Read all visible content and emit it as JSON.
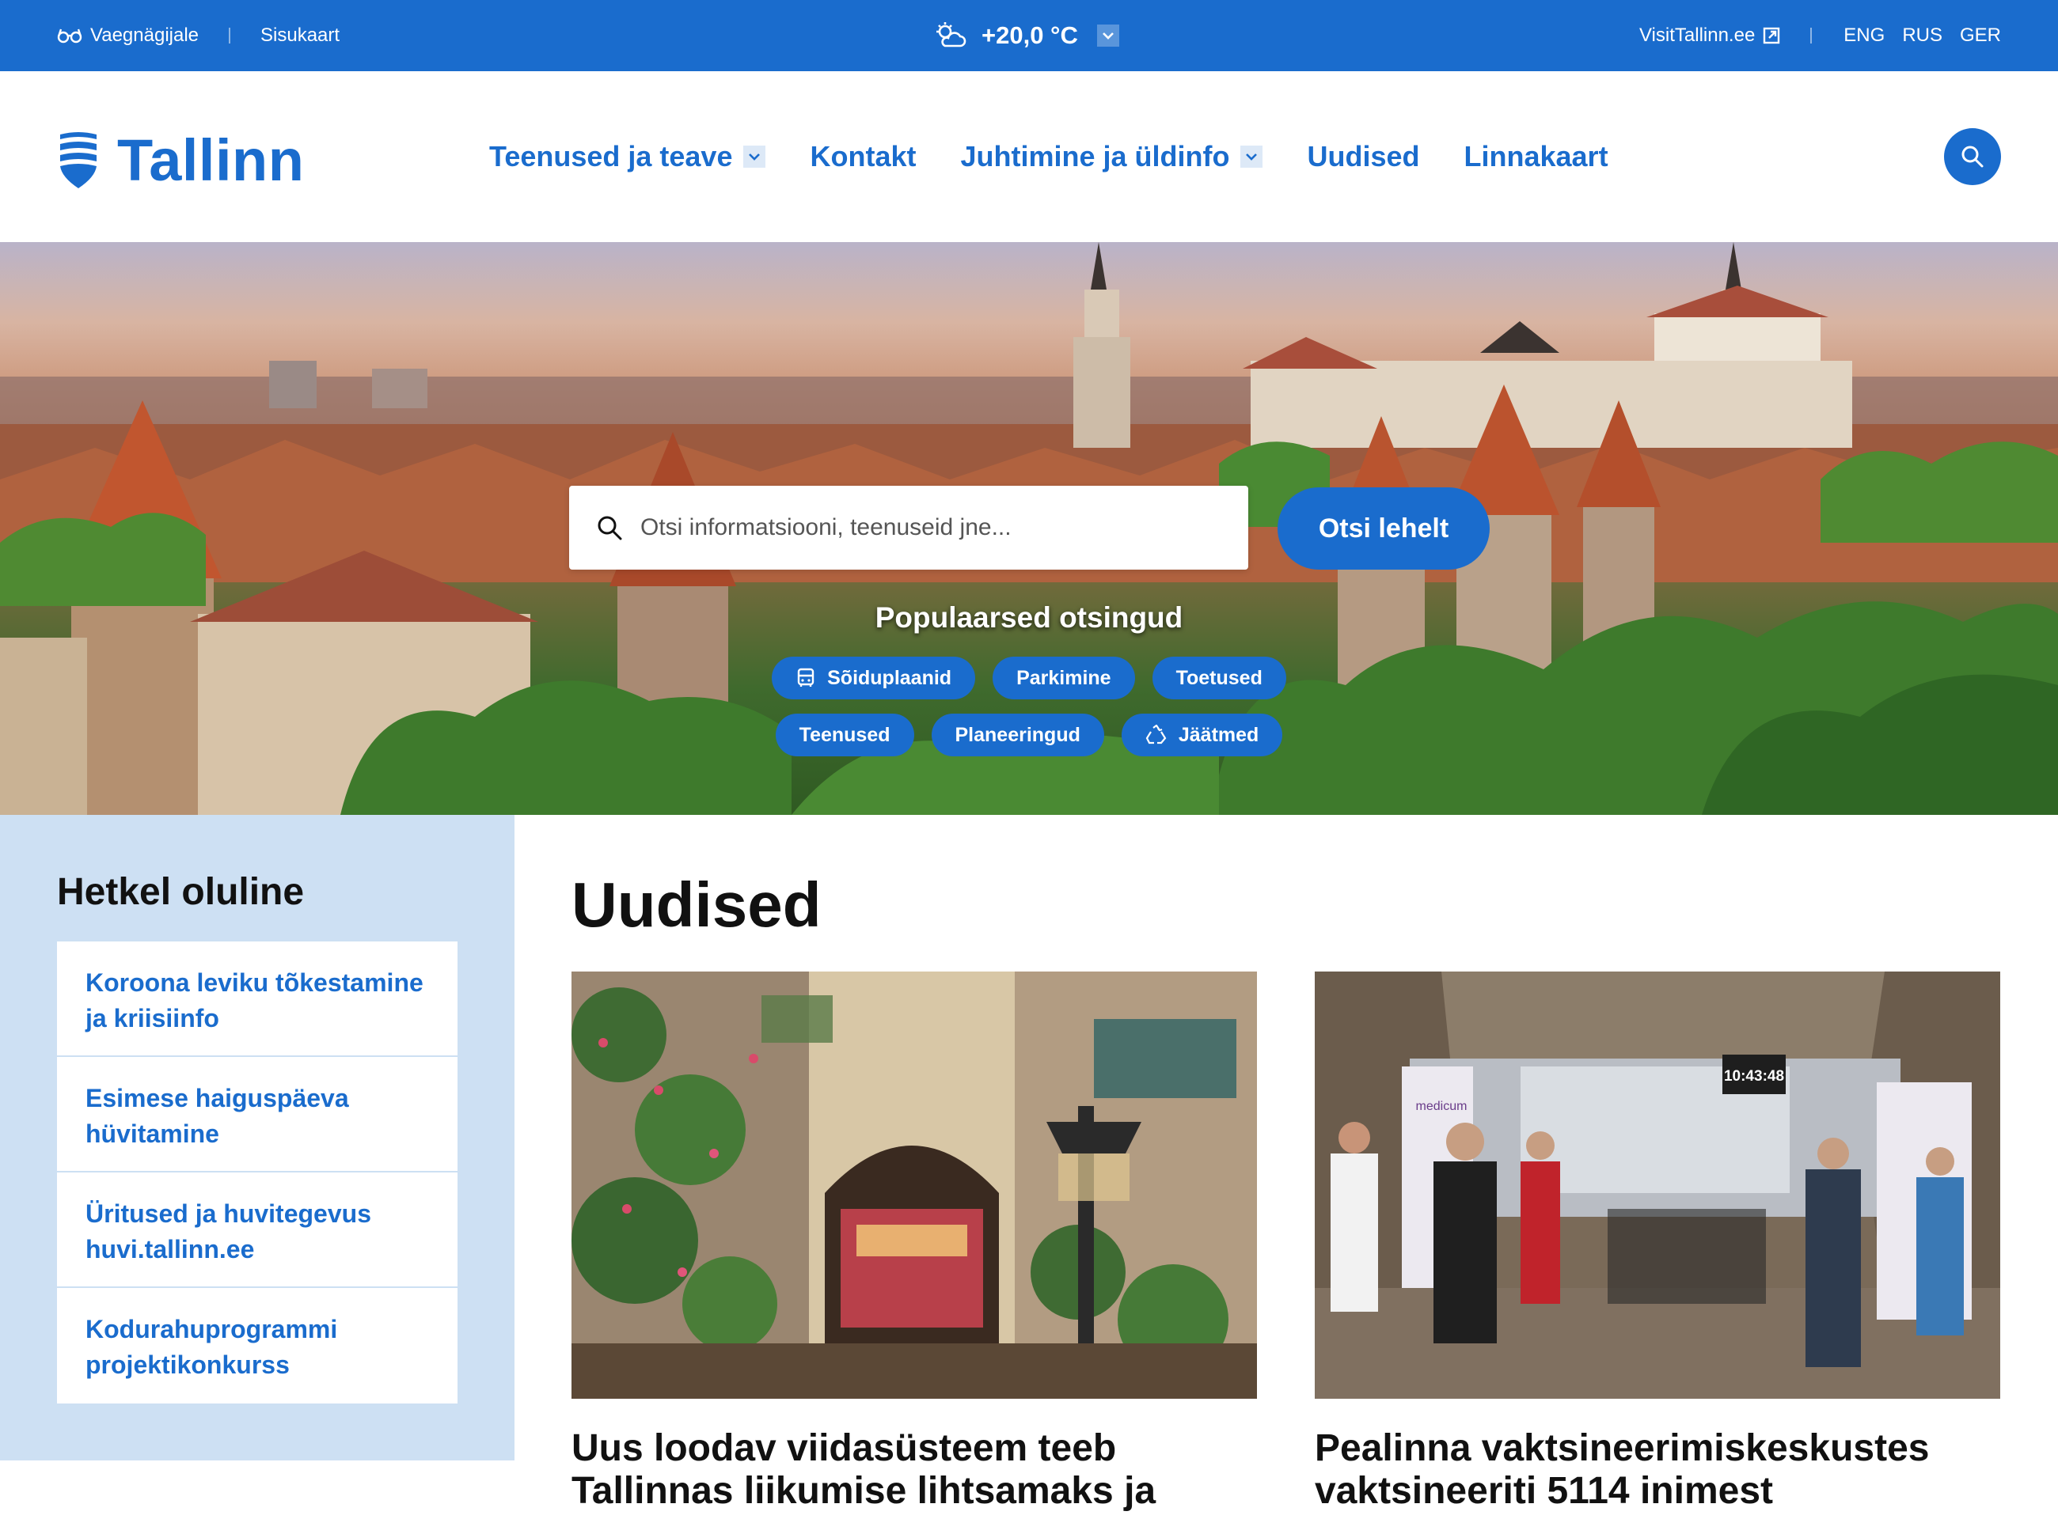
{
  "topbar": {
    "accessibility_label": "Vaegnägijale",
    "sitemap_label": "Sisukaart",
    "weather_temp": "+20,0 °C",
    "visit_label": "VisitTallinn.ee",
    "languages": [
      "ENG",
      "RUS",
      "GER"
    ]
  },
  "header": {
    "logo_text": "Tallinn",
    "nav": [
      {
        "label": "Teenused ja teave",
        "dropdown": true
      },
      {
        "label": "Kontakt",
        "dropdown": false
      },
      {
        "label": "Juhtimine ja üldinfo",
        "dropdown": true
      },
      {
        "label": "Uudised",
        "dropdown": false
      },
      {
        "label": "Linnakaart",
        "dropdown": false
      }
    ]
  },
  "hero": {
    "search_placeholder": "Otsi informatsiooni, teenuseid jne...",
    "search_button": "Otsi lehelt",
    "popular_title": "Populaarsed otsingud",
    "chips_row1": [
      "Sõiduplaanid",
      "Parkimine",
      "Toetused"
    ],
    "chips_row2": [
      "Teenused",
      "Planeeringud",
      "Jäätmed"
    ]
  },
  "important": {
    "title": "Hetkel oluline",
    "items": [
      "Koroona leviku tõkestamine ja kriisiinfo",
      "Esimese haiguspäeva hüvitamine",
      "Üritused ja huvitegevus huvi.tallinn.ee",
      "Kodurahuprogrammi projektikonkurss"
    ]
  },
  "news": {
    "title": "Uudised",
    "cards": [
      {
        "headline": "Uus loodav viidasüsteem teeb Tallinnas liikumise lihtsamaks ja"
      },
      {
        "headline": "Pealinna vaktsineerimiskeskustes vaktsineeriti 5114 inimest",
        "clock_text": "10:43:48",
        "banner_text": "medicum"
      }
    ]
  },
  "colors": {
    "brand_blue": "#1a6ccd",
    "panel_blue": "#cde0f3",
    "text_dark": "#111111"
  }
}
